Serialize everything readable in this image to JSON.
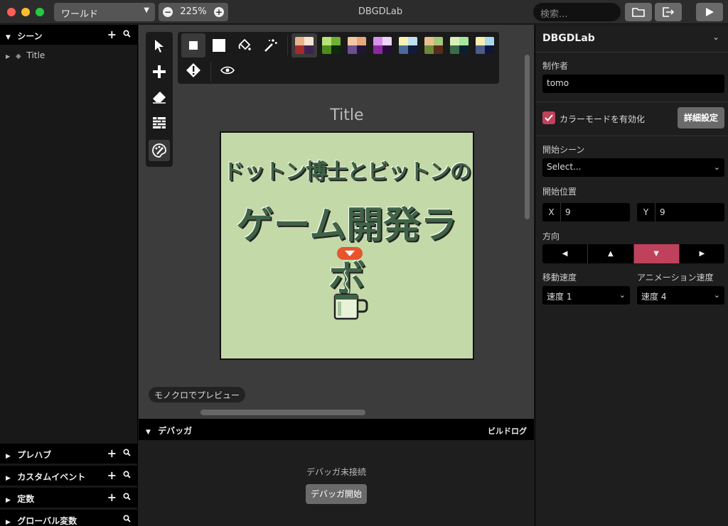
{
  "titlebar": {
    "world_select": "ワールド",
    "zoom": "225%",
    "app_title": "DBGDLab",
    "search_placeholder": "検索..."
  },
  "left_panel": {
    "scenes_header": "シーン",
    "scene_items": [
      "Title"
    ],
    "prefabs_header": "プレハブ",
    "custom_events_header": "カスタムイベント",
    "constants_header": "定数",
    "global_vars_header": "グローバル変数"
  },
  "canvas": {
    "scene_title": "Title",
    "scene_text_line1": "ドットン博士とビットンの",
    "scene_text_line2": "ゲーム開発ラボ",
    "mono_preview_button": "モノクロでプレビュー",
    "palettes": [
      [
        "#e8b48a",
        "#f4e6d0",
        "#a52a2a",
        "#3a2456"
      ],
      [
        "#b9e07a",
        "#6fb130",
        "#4d8a1f",
        "#0c2a0c"
      ],
      [
        "#f2c8a2",
        "#e7a87c",
        "#6b4f8f",
        "#1e1636"
      ],
      [
        "#d991f0",
        "#f0d4f9",
        "#8a2a9a",
        "#2a0a3a"
      ],
      [
        "#f7f2b0",
        "#bfe0f0",
        "#4a6a9a",
        "#101a3a"
      ],
      [
        "#e8c090",
        "#a5c978",
        "#6a8a3a",
        "#5a2a1a"
      ],
      [
        "#d8f0b8",
        "#a8e6a0",
        "#3a6a4a",
        "#0a2030"
      ],
      [
        "#f4eeb0",
        "#a8d8f0",
        "#4a5a8a",
        "#10143a"
      ]
    ]
  },
  "debugger": {
    "header": "デバッガ",
    "build_log": "ビルドログ",
    "status": "デバッガ未接続",
    "start_button": "デバッガ開始"
  },
  "inspector": {
    "project_name": "DBGDLab",
    "author_label": "制作者",
    "author_value": "tomo",
    "color_mode_label": "カラーモードを有効化",
    "advanced_button": "詳細設定",
    "start_scene_label": "開始シーン",
    "start_scene_value": "Select...",
    "start_position_label": "開始位置",
    "x_label": "X",
    "x_value": "9",
    "y_label": "Y",
    "y_value": "9",
    "direction_label": "方向",
    "move_speed_label": "移動速度",
    "move_speed_value": "速度 1",
    "anim_speed_label": "アニメーション速度",
    "anim_speed_value": "速度 4"
  },
  "colors": {
    "accent": "#c0415c",
    "scene_bg": "#c4d9a8",
    "scene_ink": "#3f6346",
    "arrow": "#e8552c"
  }
}
